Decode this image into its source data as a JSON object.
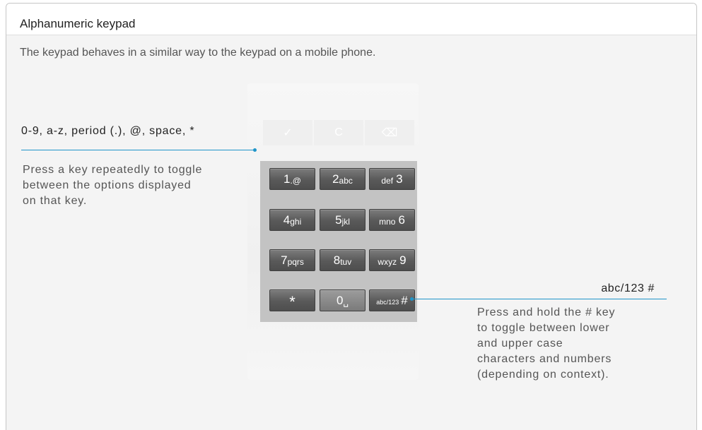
{
  "header": {
    "title": "Alphanumeric keypad",
    "subtitle": "The keypad behaves in a similar way to the keypad on a mobile phone."
  },
  "device": {
    "top_row": [
      "✓",
      "C",
      "⌫"
    ]
  },
  "keys": [
    {
      "main": "1",
      "sub": ".@"
    },
    {
      "main": "2",
      "sub": "abc"
    },
    {
      "sub": "def",
      "main": "3"
    },
    {
      "main": "4",
      "sub": "ghi"
    },
    {
      "main": "5",
      "sub": "jkl"
    },
    {
      "sub": "mno",
      "main": "6"
    },
    {
      "main": "7",
      "sub": "pqrs"
    },
    {
      "main": "8",
      "sub": "tuv"
    },
    {
      "sub": "wxyz",
      "main": "9"
    },
    {
      "main": "*"
    },
    {
      "main": "0",
      "sub": "␣"
    },
    {
      "sub": "abc/123",
      "main": "#"
    }
  ],
  "callout_left": {
    "heading": "0-9, a-z, period (.), @, space, *",
    "body": "Press a key repeatedly to toggle between the options displayed on that key."
  },
  "callout_right": {
    "heading": "abc/123 #",
    "body": "Press and hold the # key to toggle between lower and upper case characters and numbers (depending on context)."
  },
  "colors": {
    "accent": "#1f95c9",
    "key": "#5a5a5a",
    "keypad_bg": "#c3c3c3"
  }
}
